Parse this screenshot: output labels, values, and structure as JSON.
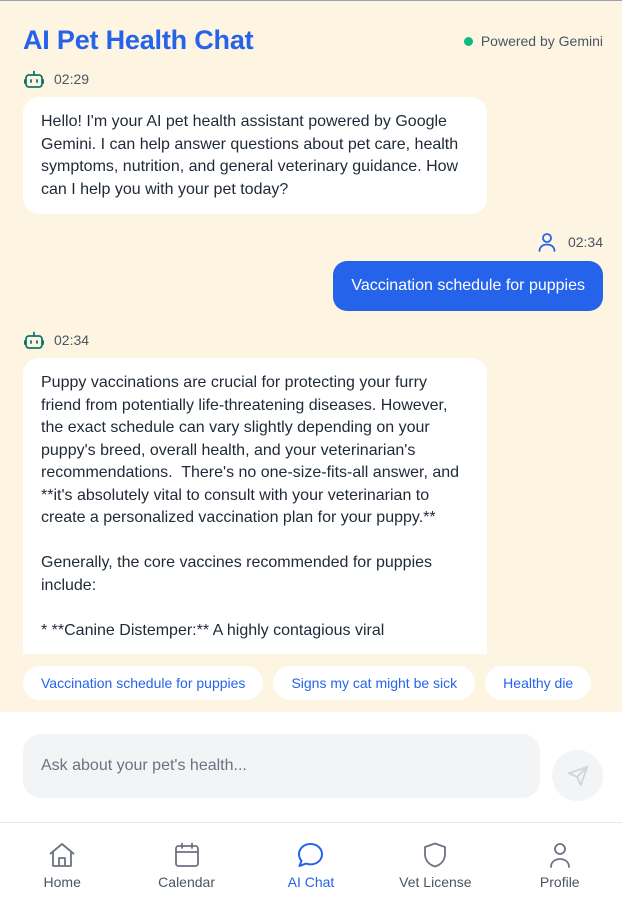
{
  "header": {
    "title": "AI Pet Health Chat",
    "powered_by": "Powered by Gemini",
    "status_color": "#10b981"
  },
  "messages": [
    {
      "role": "assistant",
      "icon": "bot-icon",
      "time": "02:29",
      "text": "Hello! I'm your AI pet health assistant powered by Google Gemini. I can help answer questions about pet care, health symptoms, nutrition, and general veterinary guidance. How can I help you with your pet today?"
    },
    {
      "role": "user",
      "icon": "user-icon",
      "time": "02:34",
      "text": "Vaccination schedule for puppies"
    },
    {
      "role": "assistant",
      "icon": "bot-icon",
      "time": "02:34",
      "text": "Puppy vaccinations are crucial for protecting your furry friend from potentially life-threatening diseases. However, the exact schedule can vary slightly depending on your puppy's breed, overall health, and your veterinarian's recommendations.  There's no one-size-fits-all answer, and **it's absolutely vital to consult with your veterinarian to create a personalized vaccination plan for your puppy.**\n\nGenerally, the core vaccines recommended for puppies include:\n\n* **Canine Distemper:** A highly contagious viral"
    }
  ],
  "suggestions": [
    "Vaccination schedule for puppies",
    "Signs my cat might be sick",
    "Healthy die"
  ],
  "input": {
    "placeholder": "Ask about your pet's health...",
    "value": ""
  },
  "nav": [
    {
      "label": "Home",
      "icon": "home-icon",
      "active": false
    },
    {
      "label": "Calendar",
      "icon": "calendar-icon",
      "active": false
    },
    {
      "label": "AI Chat",
      "icon": "chat-icon",
      "active": true
    },
    {
      "label": "Vet License",
      "icon": "shield-icon",
      "active": false
    },
    {
      "label": "Profile",
      "icon": "profile-icon",
      "active": false
    }
  ],
  "colors": {
    "accent": "#2563eb",
    "background": "#fdf5e1",
    "bot_icon": "#0f766e"
  }
}
